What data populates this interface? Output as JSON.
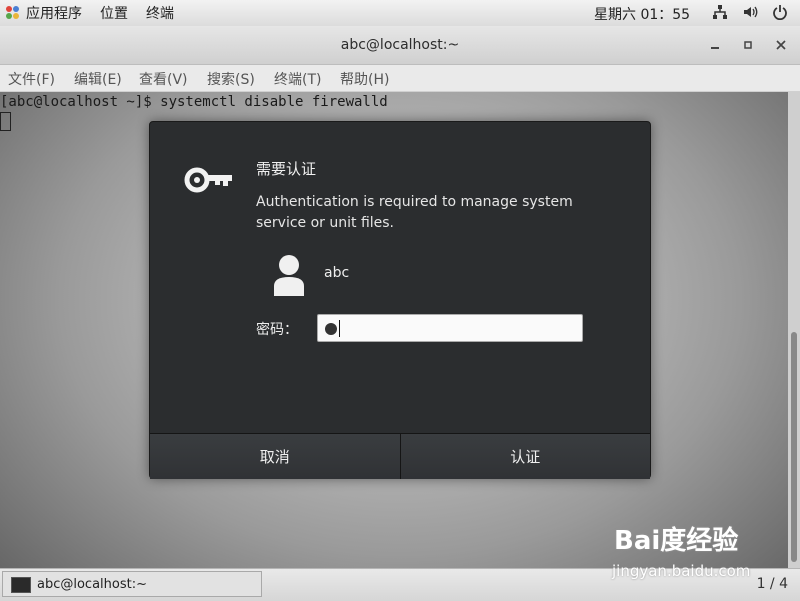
{
  "topbar": {
    "apps_label": "应用程序",
    "places_label": "位置",
    "terminal_label": "终端",
    "clock": "星期六 01：55"
  },
  "window": {
    "title": "abc@localhost:~"
  },
  "menubar": {
    "items": [
      "文件(F)",
      "编辑(E)",
      "查看(V)",
      "搜索(S)",
      "终端(T)",
      "帮助(H)"
    ]
  },
  "terminal": {
    "prompt_line": "[abc@localhost ~]$ systemctl disable firewalld"
  },
  "dialog": {
    "title": "需要认证",
    "message": "Authentication is required to manage system service or unit files.",
    "username": "abc",
    "password_label": "密码：",
    "cancel_label": "取消",
    "auth_label": "认证"
  },
  "taskbar": {
    "task_label": "abc@localhost:~",
    "pager": "1 / 4"
  },
  "watermark": {
    "logo": "Bai度经验",
    "url": "jingyan.baidu.com"
  }
}
